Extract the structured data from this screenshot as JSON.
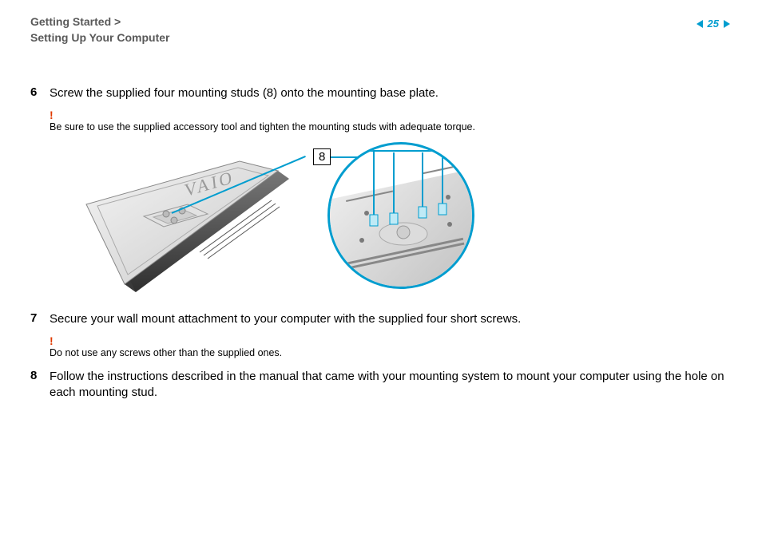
{
  "header": {
    "breadcrumb_line1": "Getting Started >",
    "breadcrumb_line2": "Setting Up Your Computer",
    "page_number": "25"
  },
  "steps": [
    {
      "num": "6",
      "text": "Screw the supplied four mounting studs (8) onto the mounting base plate.",
      "warn": "Be sure to use the supplied accessory tool and tighten the mounting studs with adequate torque."
    },
    {
      "num": "7",
      "text": "Secure your wall mount attachment to your computer with the supplied four short screws.",
      "warn": "Do not use any screws other than the supplied ones."
    },
    {
      "num": "8",
      "text": "Follow the instructions described in the manual that came with your mounting system to mount your computer using the hole on each mounting stud.",
      "warn": null
    }
  ],
  "figure": {
    "callout_label": "8"
  },
  "icons": {
    "bang": "!"
  }
}
